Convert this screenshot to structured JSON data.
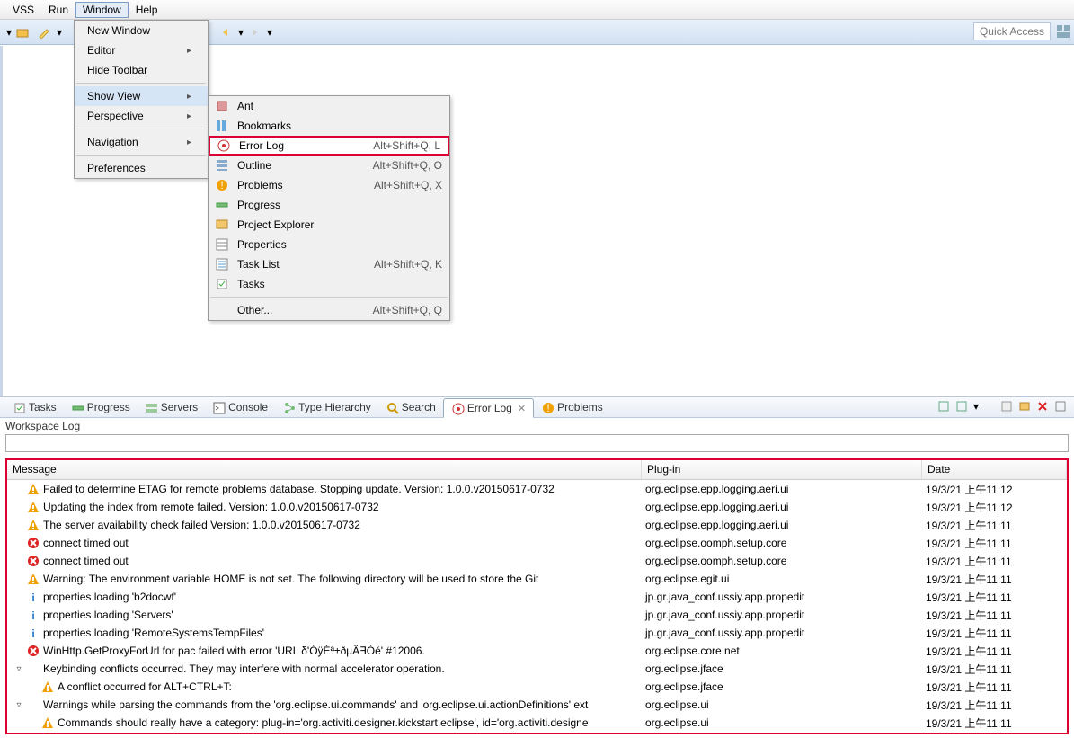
{
  "menubar": [
    "VSS",
    "Run",
    "Window",
    "Help"
  ],
  "menubar_open_index": 2,
  "toolbar": {
    "quick_access": "Quick Access"
  },
  "window_menu": {
    "items": [
      {
        "label": "New Window"
      },
      {
        "label": "Editor",
        "sub": true
      },
      {
        "label": "Hide Toolbar"
      },
      {
        "sep": true
      },
      {
        "label": "Show View",
        "sub": true,
        "hover": true
      },
      {
        "label": "Perspective",
        "sub": true
      },
      {
        "sep": true
      },
      {
        "label": "Navigation",
        "sub": true
      },
      {
        "sep": true
      },
      {
        "label": "Preferences"
      }
    ]
  },
  "show_view_submenu": [
    {
      "icon": "ant",
      "label": "Ant",
      "accel": ""
    },
    {
      "icon": "bookmarks",
      "label": "Bookmarks",
      "accel": ""
    },
    {
      "icon": "errorlog",
      "label": "Error Log",
      "accel": "Alt+Shift+Q, L",
      "highlight": true
    },
    {
      "icon": "outline",
      "label": "Outline",
      "accel": "Alt+Shift+Q, O"
    },
    {
      "icon": "problems",
      "label": "Problems",
      "accel": "Alt+Shift+Q, X"
    },
    {
      "icon": "progress",
      "label": "Progress",
      "accel": ""
    },
    {
      "icon": "project-explorer",
      "label": "Project Explorer",
      "accel": ""
    },
    {
      "icon": "properties",
      "label": "Properties",
      "accel": ""
    },
    {
      "icon": "tasklist",
      "label": "Task List",
      "accel": "Alt+Shift+Q, K"
    },
    {
      "icon": "tasks",
      "label": "Tasks",
      "accel": ""
    },
    {
      "sep": true
    },
    {
      "icon": "",
      "label": "Other...",
      "accel": "Alt+Shift+Q, Q"
    }
  ],
  "view_tabs": [
    {
      "icon": "tasks",
      "label": "Tasks"
    },
    {
      "icon": "progress",
      "label": "Progress"
    },
    {
      "icon": "servers",
      "label": "Servers"
    },
    {
      "icon": "console",
      "label": "Console"
    },
    {
      "icon": "type-hierarchy",
      "label": "Type Hierarchy"
    },
    {
      "icon": "search",
      "label": "Search"
    },
    {
      "icon": "errorlog",
      "label": "Error Log",
      "active": true,
      "closable": true
    },
    {
      "icon": "problems",
      "label": "Problems"
    }
  ],
  "workspace_log_label": "Workspace Log",
  "filter_value": "",
  "columns": {
    "message": "Message",
    "plugin": "Plug-in",
    "date": "Date"
  },
  "rows": [
    {
      "lvl": "warn",
      "indent": 0,
      "exp": "",
      "msg": "Failed to determine ETAG for remote problems database. Stopping update. Version: 1.0.0.v20150617-0732",
      "plugin": "org.eclipse.epp.logging.aeri.ui",
      "date": "19/3/21 上午11:12"
    },
    {
      "lvl": "warn",
      "indent": 0,
      "exp": "",
      "msg": "Updating the index from remote failed. Version: 1.0.0.v20150617-0732",
      "plugin": "org.eclipse.epp.logging.aeri.ui",
      "date": "19/3/21 上午11:12"
    },
    {
      "lvl": "warn",
      "indent": 0,
      "exp": "",
      "msg": "The server availability check failed Version: 1.0.0.v20150617-0732",
      "plugin": "org.eclipse.epp.logging.aeri.ui",
      "date": "19/3/21 上午11:11"
    },
    {
      "lvl": "err",
      "indent": 0,
      "exp": "",
      "msg": "connect timed out",
      "plugin": "org.eclipse.oomph.setup.core",
      "date": "19/3/21 上午11:11"
    },
    {
      "lvl": "err",
      "indent": 0,
      "exp": "",
      "msg": "connect timed out",
      "plugin": "org.eclipse.oomph.setup.core",
      "date": "19/3/21 上午11:11"
    },
    {
      "lvl": "warn",
      "indent": 0,
      "exp": "",
      "msg": "Warning: The environment variable HOME is not set. The following directory will be used to store the Git",
      "plugin": "org.eclipse.egit.ui",
      "date": "19/3/21 上午11:11"
    },
    {
      "lvl": "info",
      "indent": 0,
      "exp": "",
      "msg": "properties loading 'b2docwf'",
      "plugin": "jp.gr.java_conf.ussiy.app.propedit",
      "date": "19/3/21 上午11:11"
    },
    {
      "lvl": "info",
      "indent": 0,
      "exp": "",
      "msg": "properties loading 'Servers'",
      "plugin": "jp.gr.java_conf.ussiy.app.propedit",
      "date": "19/3/21 上午11:11"
    },
    {
      "lvl": "info",
      "indent": 0,
      "exp": "",
      "msg": "properties loading 'RemoteSystemsTempFiles'",
      "plugin": "jp.gr.java_conf.ussiy.app.propedit",
      "date": "19/3/21 上午11:11"
    },
    {
      "lvl": "errx",
      "indent": 0,
      "exp": "",
      "msg": "WinHttp.GetProxyForUrl for pac failed with error 'URL δ'ÓÿÉª±ðµÄ∃Òé' #12006.",
      "plugin": "org.eclipse.core.net",
      "date": "19/3/21 上午11:11"
    },
    {
      "lvl": "none",
      "indent": 0,
      "exp": "▿",
      "msg": "Keybinding conflicts occurred.  They may interfere with normal accelerator operation.",
      "plugin": "org.eclipse.jface",
      "date": "19/3/21 上午11:11"
    },
    {
      "lvl": "warn",
      "indent": 1,
      "exp": "",
      "msg": "A conflict occurred for ALT+CTRL+T:",
      "plugin": "org.eclipse.jface",
      "date": "19/3/21 上午11:11"
    },
    {
      "lvl": "none",
      "indent": 0,
      "exp": "▿",
      "msg": "Warnings while parsing the commands from the 'org.eclipse.ui.commands' and 'org.eclipse.ui.actionDefinitions' ext",
      "plugin": "org.eclipse.ui",
      "date": "19/3/21 上午11:11"
    },
    {
      "lvl": "warn",
      "indent": 1,
      "exp": "",
      "msg": "Commands should really have a category: plug-in='org.activiti.designer.kickstart.eclipse', id='org.activiti.designe",
      "plugin": "org.eclipse.ui",
      "date": "19/3/21 上午11:11"
    }
  ]
}
